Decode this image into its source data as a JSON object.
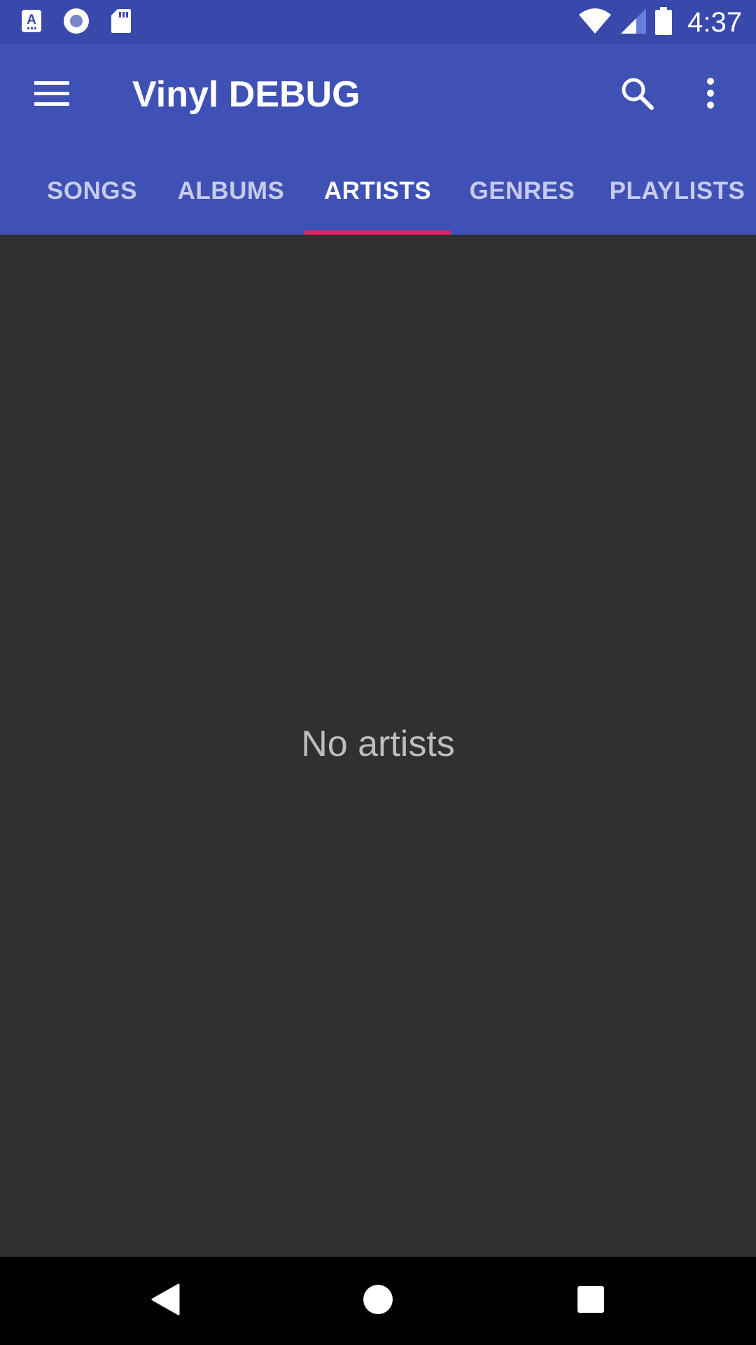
{
  "status_bar": {
    "time": "4:37",
    "left_icons": [
      "text-input-notification-icon",
      "record-notification-icon",
      "sd-card-icon"
    ],
    "right_icons": [
      "wifi-icon",
      "cell-signal-icon",
      "battery-icon"
    ]
  },
  "toolbar": {
    "title": "Vinyl DEBUG",
    "nav_icon": "menu-icon",
    "actions": [
      "search-icon",
      "more-vert-icon"
    ]
  },
  "tabs": [
    {
      "label": "SONGS",
      "active": false
    },
    {
      "label": "ALBUMS",
      "active": false
    },
    {
      "label": "ARTISTS",
      "active": true
    },
    {
      "label": "GENRES",
      "active": false
    },
    {
      "label": "PLAYLISTS",
      "active": false
    }
  ],
  "content": {
    "empty_message": "No artists"
  },
  "nav_bar": {
    "keys": [
      "back-icon",
      "home-icon",
      "recents-icon"
    ]
  },
  "colors": {
    "status_bar": "#3949AB",
    "app_bar": "#3F51B5",
    "tab_indicator": "#E91E63",
    "background": "#303030",
    "empty_text": "#BDBDBD"
  }
}
